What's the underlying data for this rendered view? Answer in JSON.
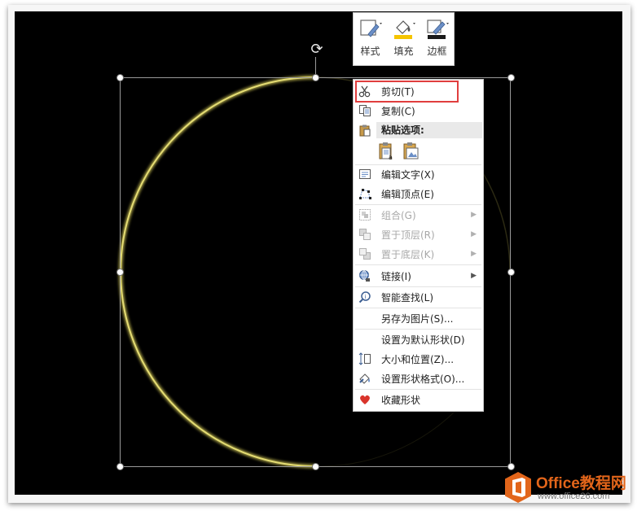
{
  "mini_toolbar": {
    "style_label": "样式",
    "fill_label": "填充",
    "border_label": "边框",
    "fill_color": "#f5c400",
    "border_color": "#1a1a1a"
  },
  "context_menu": {
    "cut": "剪切(T)",
    "copy": "复制(C)",
    "paste_options": "粘贴选项:",
    "edit_text": "编辑文字(X)",
    "edit_points": "编辑顶点(E)",
    "group": "组合(G)",
    "bring_to_front": "置于顶层(R)",
    "send_to_back": "置于底层(K)",
    "link": "链接(I)",
    "smart_lookup": "智能查找(L)",
    "save_as_picture": "另存为图片(S)...",
    "set_default_shape": "设置为默认形状(D)",
    "size_position": "大小和位置(Z)...",
    "format_shape": "设置形状格式(O)...",
    "favorite_shape": "收藏形状"
  },
  "watermark": {
    "title": "Office教程网",
    "url": "www.office26.com",
    "brand_color": "#e2651a"
  },
  "colors": {
    "highlight": "#e03e3e",
    "moon_glow": "#d8d25a",
    "canvas": "#000000"
  }
}
